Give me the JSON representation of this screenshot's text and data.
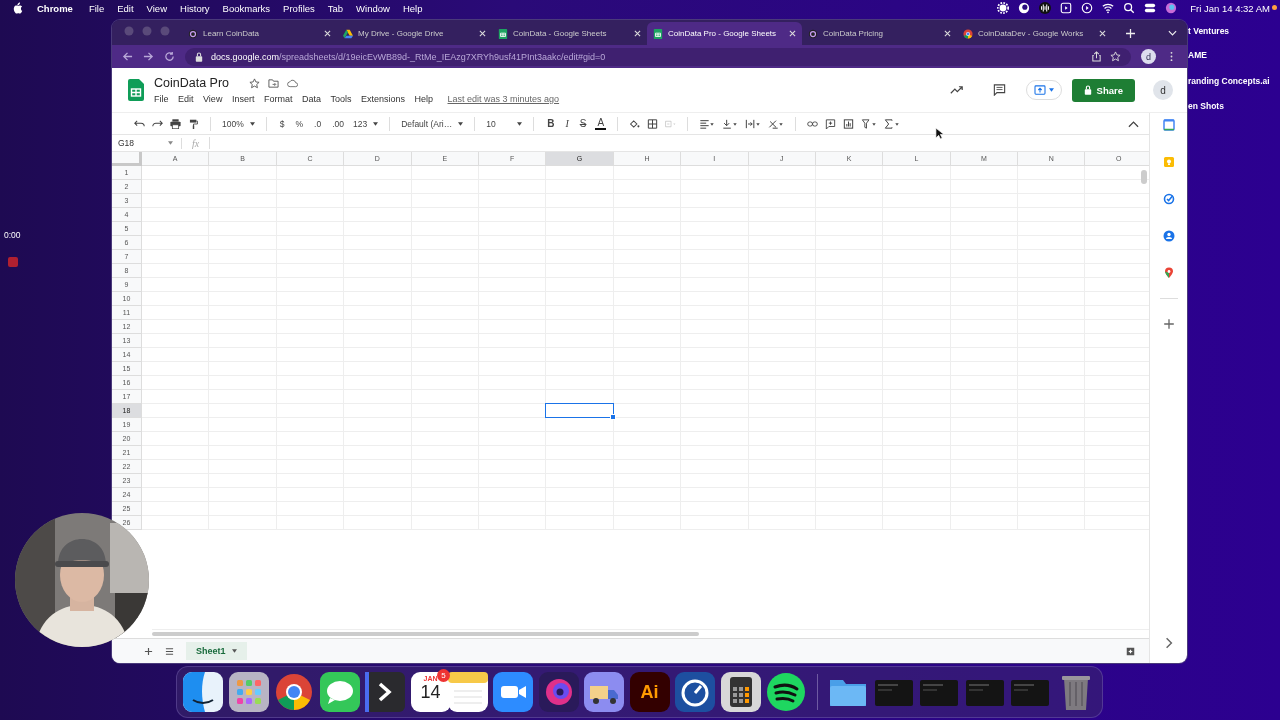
{
  "menubar": {
    "app": "Chrome",
    "items": [
      "File",
      "Edit",
      "View",
      "History",
      "Bookmarks",
      "Profiles",
      "Tab",
      "Window",
      "Help"
    ],
    "clock": "Fri Jan 14 4:32 AM"
  },
  "desktop": {
    "labels": [
      "t Ventures",
      "AME",
      "randing Concepts.ai",
      "en Shots"
    ]
  },
  "recorder": {
    "time": "0:00"
  },
  "browser": {
    "tabs": [
      {
        "title": "Learn CoinData",
        "kind": "coin",
        "selected": false
      },
      {
        "title": "My Drive - Google Drive",
        "kind": "drive",
        "selected": false
      },
      {
        "title": "CoinData - Google Sheets",
        "kind": "sheets",
        "selected": false
      },
      {
        "title": "CoinData Pro - Google Sheets",
        "kind": "sheets",
        "selected": true
      },
      {
        "title": "CoinData Pricing",
        "kind": "coin",
        "selected": false
      },
      {
        "title": "CoinDataDev - Google Works",
        "kind": "chrome",
        "selected": false
      }
    ],
    "url": {
      "host": "docs.google.com",
      "path": "/spreadsheets/d/19eicEvWB89d-_RtMe_IEAzg7XRYh9usf41PInt3aakc/edit#gid=0"
    },
    "profile": "d"
  },
  "sheet": {
    "title": "CoinData Pro",
    "menu": [
      "File",
      "Edit",
      "View",
      "Insert",
      "Format",
      "Data",
      "Tools",
      "Extensions",
      "Help"
    ],
    "last_edit": "Last edit was 3 minutes ago",
    "share": "Share",
    "avatar": "d",
    "toolbar": {
      "zoom": "100%",
      "currency": "$",
      "percent": "%",
      "decrease_decimals": ".0",
      "increase_decimals": ".00",
      "number_format": "123",
      "font": "Default (Ari…",
      "font_size": "10",
      "bold": "B",
      "italic": "I",
      "strikethrough": "S",
      "text_color": "A"
    },
    "name_box": "G18",
    "fx": "fx",
    "columns": [
      {
        "label": "A",
        "selected": false
      },
      {
        "label": "B",
        "selected": false
      },
      {
        "label": "C",
        "selected": false
      },
      {
        "label": "D",
        "selected": false
      },
      {
        "label": "E",
        "selected": false
      },
      {
        "label": "F",
        "selected": false
      },
      {
        "label": "G",
        "selected": true
      },
      {
        "label": "H",
        "selected": false
      },
      {
        "label": "I",
        "selected": false
      },
      {
        "label": "J",
        "selected": false
      },
      {
        "label": "K",
        "selected": false
      },
      {
        "label": "L",
        "selected": false
      },
      {
        "label": "M",
        "selected": false
      },
      {
        "label": "N",
        "selected": false
      },
      {
        "label": "O",
        "selected": false
      }
    ],
    "rows": [
      {
        "label": "1",
        "selected": false
      },
      {
        "label": "2",
        "selected": false
      },
      {
        "label": "3",
        "selected": false
      },
      {
        "label": "4",
        "selected": false
      },
      {
        "label": "5",
        "selected": false
      },
      {
        "label": "6",
        "selected": false
      },
      {
        "label": "7",
        "selected": false
      },
      {
        "label": "8",
        "selected": false
      },
      {
        "label": "9",
        "selected": false
      },
      {
        "label": "10",
        "selected": false
      },
      {
        "label": "11",
        "selected": false
      },
      {
        "label": "12",
        "selected": false
      },
      {
        "label": "13",
        "selected": false
      },
      {
        "label": "14",
        "selected": false
      },
      {
        "label": "15",
        "selected": false
      },
      {
        "label": "16",
        "selected": false
      },
      {
        "label": "17",
        "selected": false
      },
      {
        "label": "18",
        "selected": true
      },
      {
        "label": "19",
        "selected": false
      },
      {
        "label": "20",
        "selected": false
      },
      {
        "label": "21",
        "selected": false
      },
      {
        "label": "22",
        "selected": false
      },
      {
        "label": "23",
        "selected": false
      },
      {
        "label": "24",
        "selected": false
      },
      {
        "label": "25",
        "selected": false
      },
      {
        "label": "26",
        "selected": false
      }
    ],
    "sheet_tabs": [
      {
        "label": "Sheet1",
        "selected": true
      }
    ]
  },
  "dock": [
    {
      "kind": "finder"
    },
    {
      "kind": "launchpad"
    },
    {
      "kind": "chrome"
    },
    {
      "kind": "messages"
    },
    {
      "kind": "terminal"
    },
    {
      "kind": "calendar",
      "month": "JAN",
      "day": "14",
      "badge": "5"
    },
    {
      "kind": "notes"
    },
    {
      "kind": "zoom"
    },
    {
      "kind": "swirl"
    },
    {
      "kind": "truck"
    },
    {
      "kind": "illustrator",
      "label": "Ai"
    },
    {
      "kind": "gauge"
    },
    {
      "kind": "calculator"
    },
    {
      "kind": "spotify"
    },
    {
      "kind": "separator"
    },
    {
      "kind": "folder"
    },
    {
      "kind": "thumbnail"
    },
    {
      "kind": "thumbnail"
    },
    {
      "kind": "thumbnail"
    },
    {
      "kind": "thumbnail"
    },
    {
      "kind": "trash"
    }
  ]
}
